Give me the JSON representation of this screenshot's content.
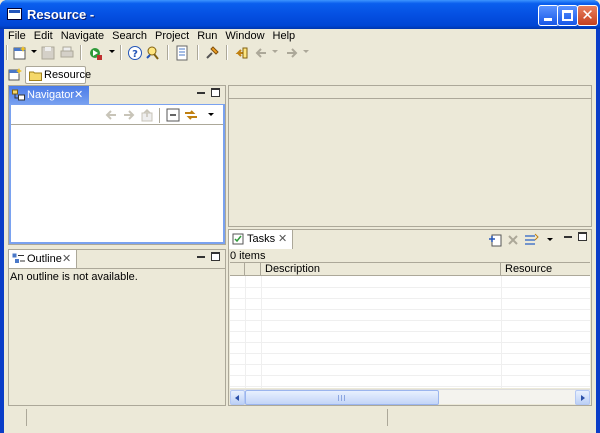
{
  "window": {
    "title": "Resource -"
  },
  "menu": [
    {
      "label": "File"
    },
    {
      "label": "Edit"
    },
    {
      "label": "Navigate"
    },
    {
      "label": "Search"
    },
    {
      "label": "Project"
    },
    {
      "label": "Run"
    },
    {
      "label": "Window"
    },
    {
      "label": "Help"
    }
  ],
  "toolbar": {
    "icons": [
      "new-wizard-icon",
      "save-icon",
      "print-icon",
      "run-icon",
      "help-icon",
      "search-icon",
      "task-icon",
      "pin-icon",
      "back-icon",
      "forward-icon"
    ]
  },
  "perspective": {
    "active_label": "Resource"
  },
  "navigator": {
    "tab_label": "Navigator",
    "close_glyph": "✕"
  },
  "outline": {
    "tab_label": "Outline",
    "close_glyph": "✕",
    "message": "An outline is not available."
  },
  "tasks": {
    "tab_label": "Tasks",
    "close_glyph": "✕",
    "count_text": "0 items",
    "columns": [
      {
        "label": ""
      },
      {
        "label": ""
      },
      {
        "label": "Description"
      },
      {
        "label": "Resource"
      }
    ]
  },
  "colors": {
    "titlebar": "#0550E2",
    "active_tab": "#4A7BE8",
    "chrome": "#ECE9D8",
    "border": "#ACA899"
  }
}
